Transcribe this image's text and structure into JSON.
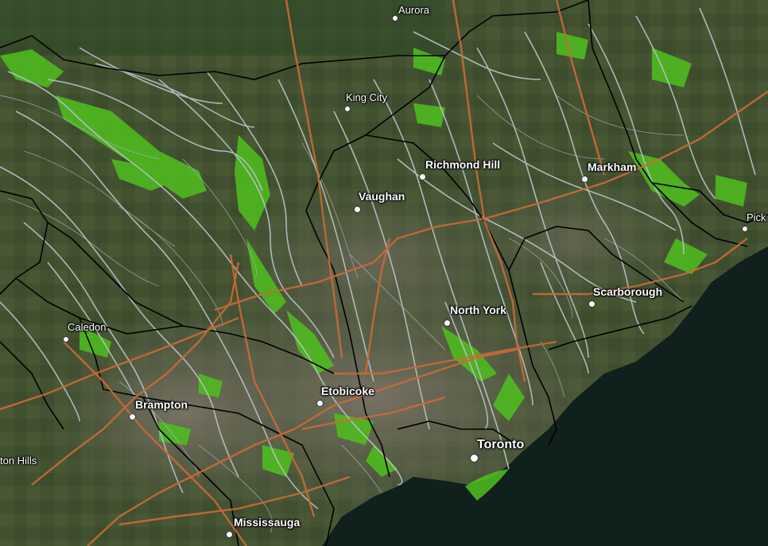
{
  "map": {
    "places": [
      {
        "id": "aurora",
        "name": "Aurora",
        "tier": "small"
      },
      {
        "id": "king-city",
        "name": "King City",
        "tier": "small"
      },
      {
        "id": "richmond-hill",
        "name": "Richmond Hill",
        "tier": "normal"
      },
      {
        "id": "markham",
        "name": "Markham",
        "tier": "normal"
      },
      {
        "id": "vaughan",
        "name": "Vaughan",
        "tier": "normal"
      },
      {
        "id": "pickering",
        "name": "Pick",
        "tier": "small"
      },
      {
        "id": "scarborough",
        "name": "Scarborough",
        "tier": "normal"
      },
      {
        "id": "north-york",
        "name": "North York",
        "tier": "normal"
      },
      {
        "id": "caledon",
        "name": "Caledon",
        "tier": "small"
      },
      {
        "id": "etobicoke",
        "name": "Etobicoke",
        "tier": "normal"
      },
      {
        "id": "brampton",
        "name": "Brampton",
        "tier": "normal"
      },
      {
        "id": "toronto",
        "name": "Toronto",
        "tier": "big"
      },
      {
        "id": "halton-hills",
        "name": "ton Hills",
        "tier": "small"
      },
      {
        "id": "mississauga",
        "name": "Mississauga",
        "tier": "normal"
      }
    ],
    "colors": {
      "land": "#3f4d30",
      "urban": "#6b6658",
      "water": "#0f1f1c",
      "green_overlay": "#4fbf1e",
      "streams": "#b9c4c9",
      "highways": "#c96a3a",
      "boundaries": "#000000"
    }
  }
}
